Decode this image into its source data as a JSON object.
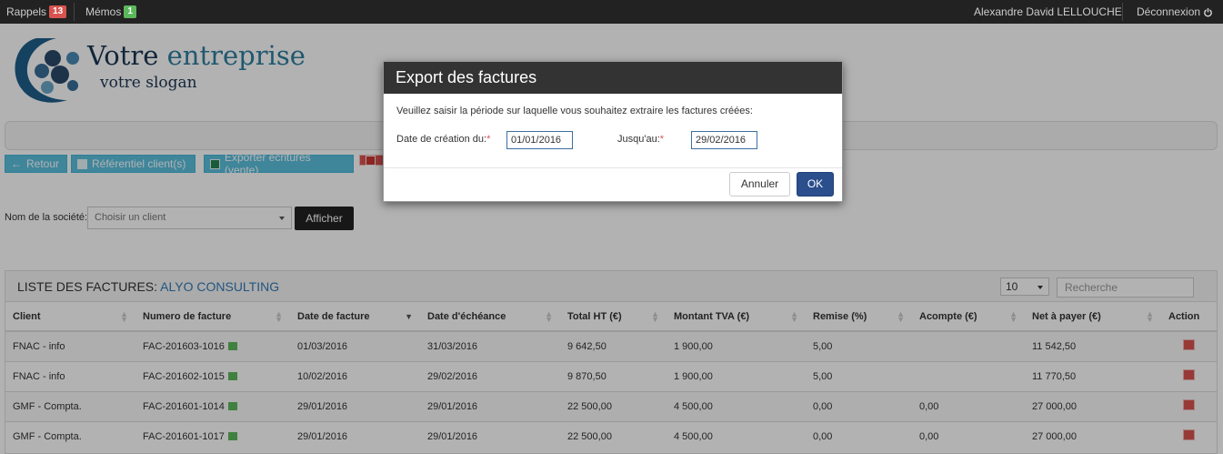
{
  "topbar": {
    "reminders_label": "Rappels",
    "reminders_count": "13",
    "memos_label": "Mémos",
    "memos_count": "1",
    "user_name": "Alexandre David LELLOUCHE",
    "logout_label": "Déconnexion",
    "logout_icon": "power-icon"
  },
  "logo": {
    "title_part1": "Votre ",
    "title_part2": "entreprise",
    "slogan": "votre slogan"
  },
  "toolbar": {
    "back_label": "Retour",
    "clients_label": "Référentiel client(s)",
    "export_label": "Exporter écritures (vente)"
  },
  "filter": {
    "label": "Nom de la société:",
    "placeholder": "Choisir un client",
    "button": "Afficher"
  },
  "list": {
    "title": "LISTE DES FACTURES:",
    "company": "ALYO CONSULTING",
    "page_size": "10",
    "search_placeholder": "Recherche",
    "columns": [
      "Client",
      "Numero de facture",
      "Date de facture",
      "Date d'échéance",
      "Total HT (€)",
      "Montant TVA (€)",
      "Remise (%)",
      "Acompte (€)",
      "Net à payer (€)",
      "Action"
    ],
    "rows": [
      [
        "FNAC - info",
        "FAC-201603-1016",
        "01/03/2016",
        "31/03/2016",
        "9 642,50",
        "1 900,00",
        "5,00",
        "",
        "11 542,50"
      ],
      [
        "FNAC - info",
        "FAC-201602-1015",
        "10/02/2016",
        "29/02/2016",
        "9 870,50",
        "1 900,00",
        "5,00",
        "",
        "11 770,50"
      ],
      [
        "GMF - Compta.",
        "FAC-201601-1014",
        "29/01/2016",
        "29/01/2016",
        "22 500,00",
        "4 500,00",
        "0,00",
        "0,00",
        "27 000,00"
      ],
      [
        "GMF - Compta.",
        "FAC-201601-1017",
        "29/01/2016",
        "29/01/2016",
        "22 500,00",
        "4 500,00",
        "0,00",
        "0,00",
        "27 000,00"
      ]
    ]
  },
  "modal": {
    "title": "Export des factures",
    "text": "Veuillez saisir la période sur laquelle vous souhaitez extraire les factures créées:",
    "from_label": "Date de création du:",
    "from_value": "01/01/2016",
    "to_label": "Jusqu'au:",
    "to_value": "29/02/2016",
    "required_mark": "*",
    "cancel_label": "Annuler",
    "ok_label": "OK"
  },
  "colors": {
    "topbar_bg": "#222222",
    "toolbar_button": "#5bc0de",
    "ok_button": "#2b4e8c",
    "modal_header": "#333333"
  }
}
